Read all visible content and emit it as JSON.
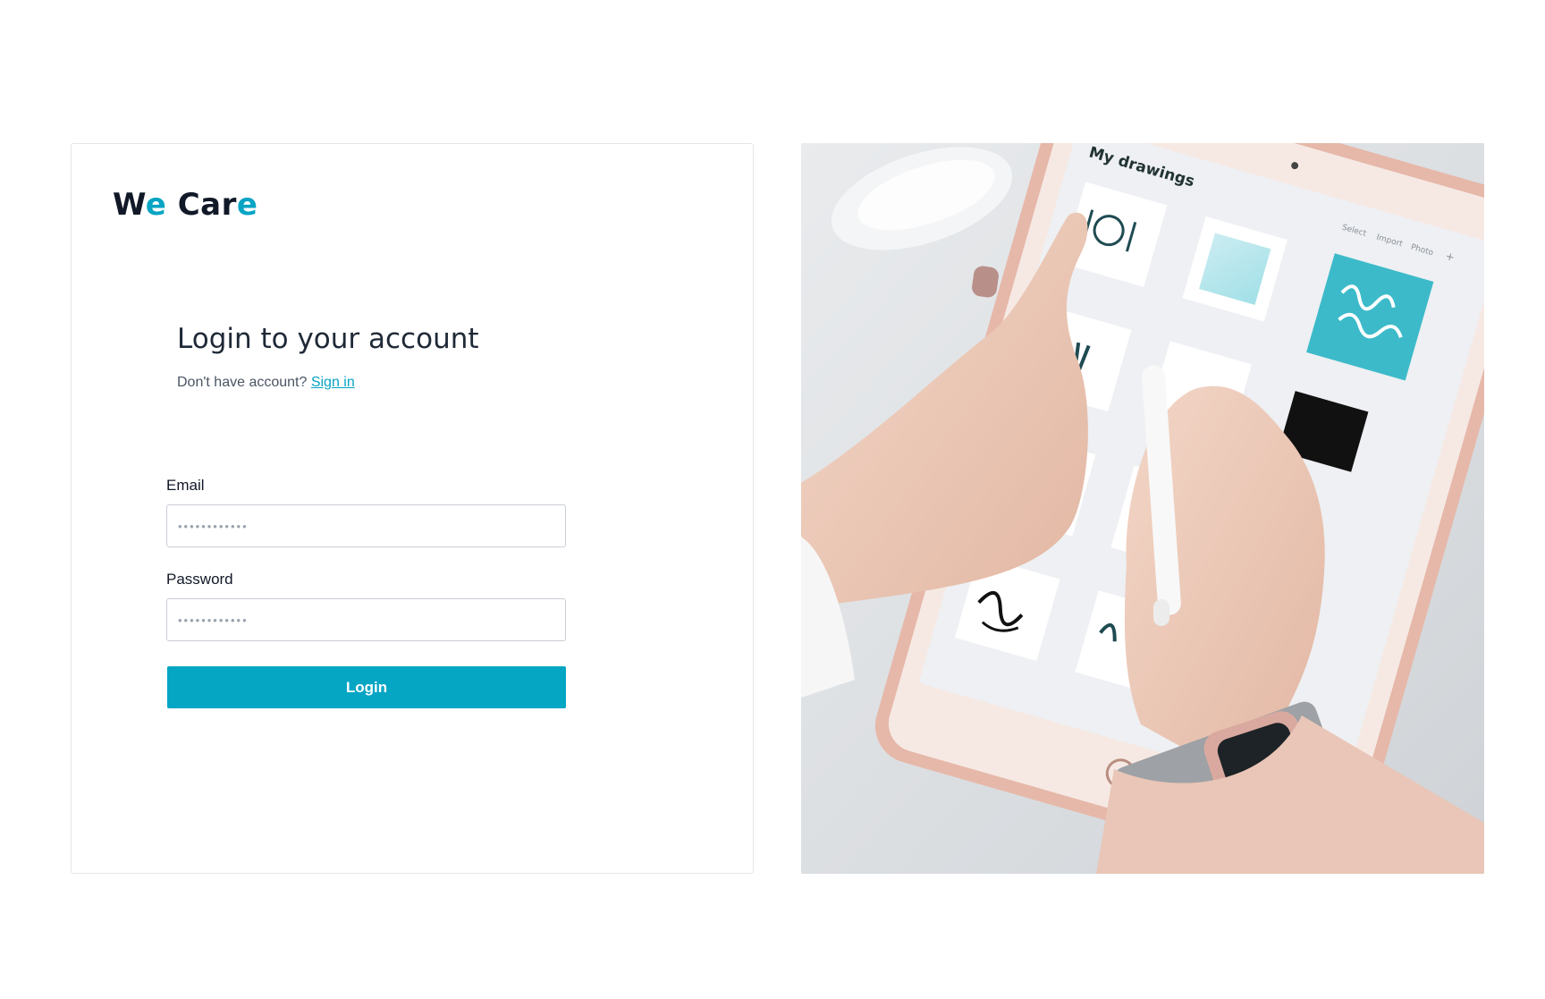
{
  "brand": {
    "logo_part1": "W",
    "logo_part2": "e",
    "logo_part3": " Car",
    "logo_part4": "e",
    "accent_color": "#07a4c3"
  },
  "login": {
    "heading": "Login to your account",
    "signup_prompt": "Don't have account?",
    "signup_link": "Sign in",
    "email_label": "Email",
    "email_placeholder": "••••••••••••",
    "password_label": "Password",
    "password_placeholder": "••••••••••••",
    "submit_label": "Login",
    "button_color": "#05a5c4"
  },
  "photo": {
    "tablet_header": "My drawings",
    "tablet_actions": [
      "Select",
      "Import",
      "Photo",
      "+"
    ]
  }
}
